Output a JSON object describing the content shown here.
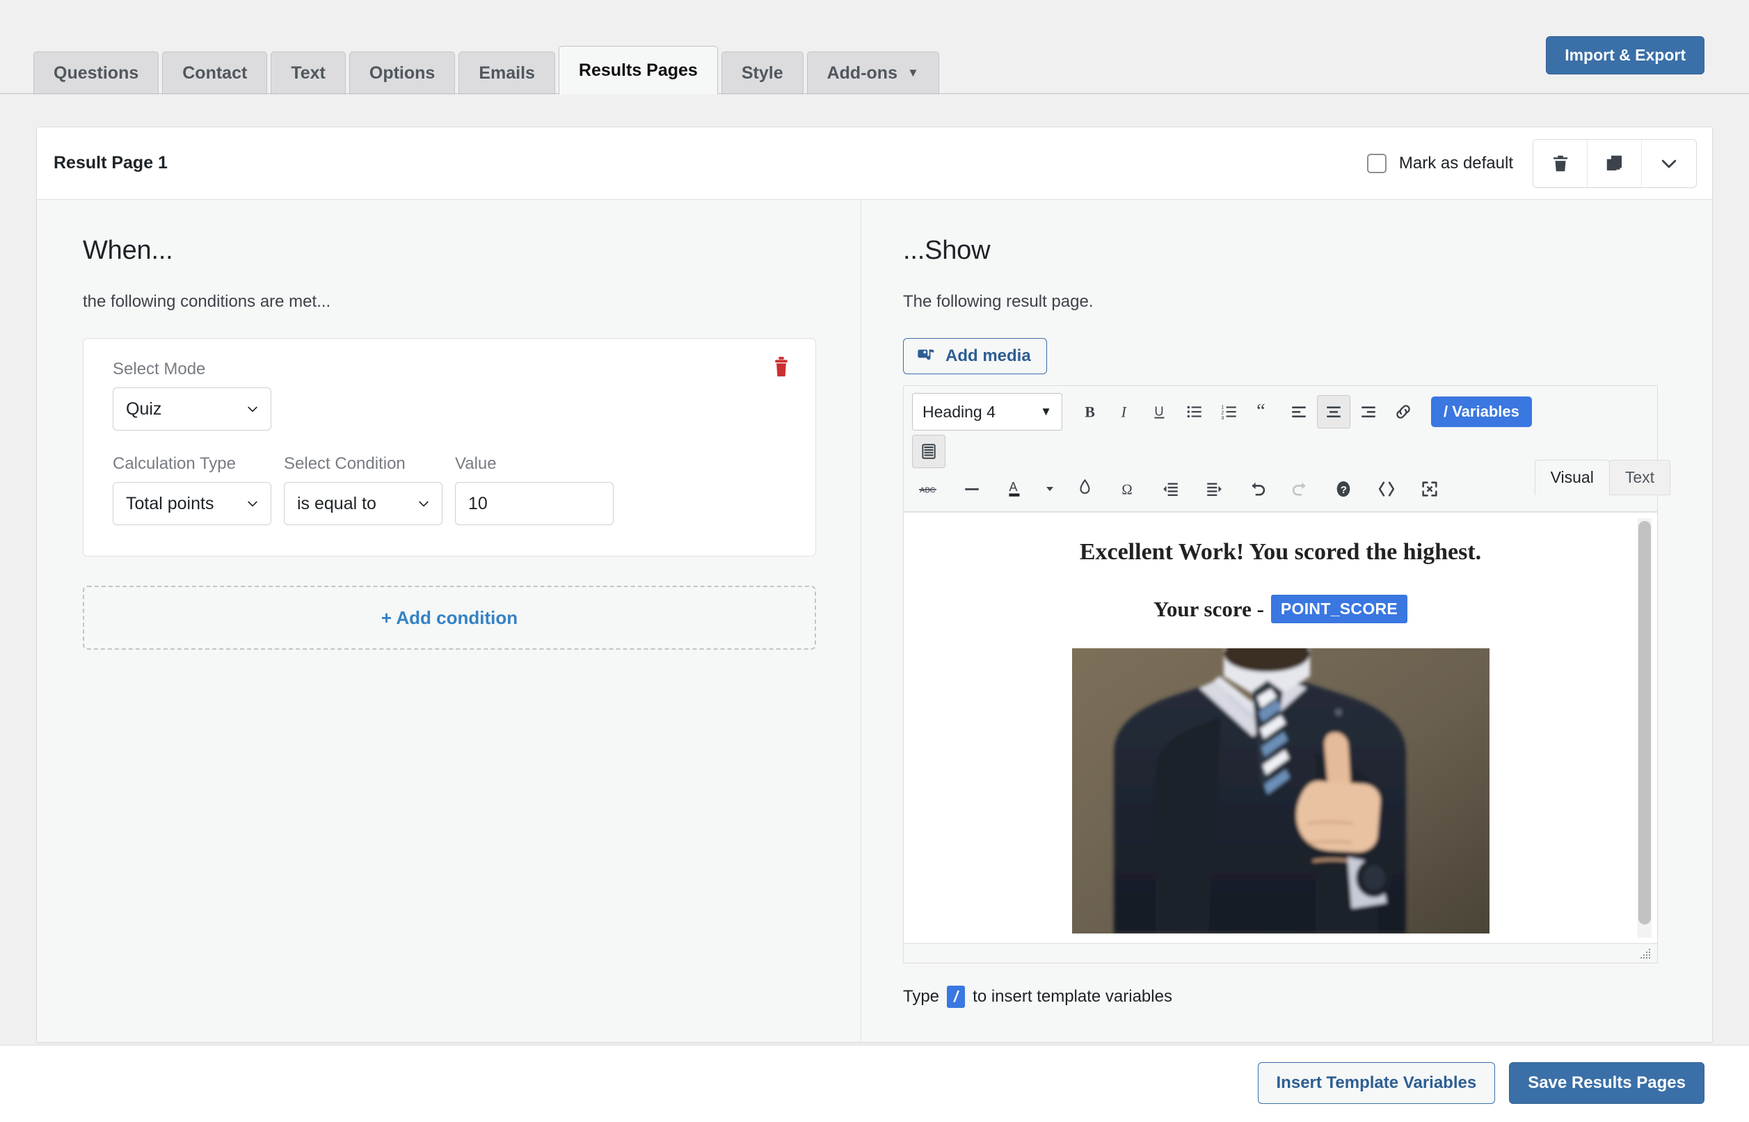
{
  "tabs": {
    "items": [
      {
        "label": "Questions",
        "active": false
      },
      {
        "label": "Contact",
        "active": false
      },
      {
        "label": "Text",
        "active": false
      },
      {
        "label": "Options",
        "active": false
      },
      {
        "label": "Emails",
        "active": false
      },
      {
        "label": "Results Pages",
        "active": true
      },
      {
        "label": "Style",
        "active": false
      },
      {
        "label": "Add-ons",
        "active": false,
        "caret": "▼"
      }
    ],
    "import_export_label": "Import & Export"
  },
  "card": {
    "title": "Result Page 1",
    "mark_default_label": "Mark as default",
    "icons": [
      "trash-icon",
      "duplicate-icon",
      "chevron-down-icon"
    ]
  },
  "when": {
    "heading": "When...",
    "subtitle": "the following conditions are met...",
    "select_mode_label": "Select Mode",
    "select_mode_value": "Quiz",
    "calculation_type_label": "Calculation Type",
    "calculation_type_value": "Total points",
    "select_condition_label": "Select Condition",
    "select_condition_value": "is equal to",
    "value_label": "Value",
    "value_value": "10",
    "value_placeholder": "",
    "add_condition_label": "+ Add condition"
  },
  "show": {
    "heading": "...Show",
    "subtitle": "The following result page.",
    "add_media_label": "Add media",
    "view_tabs": [
      {
        "label": "Visual",
        "active": true
      },
      {
        "label": "Text",
        "active": false
      }
    ],
    "toolbar": {
      "format_value": "Heading 4",
      "variables_label": "/ Variables",
      "row1_icons": [
        "bold-icon",
        "italic-icon",
        "underline-icon",
        "bulleted-list-icon",
        "numbered-list-icon",
        "blockquote-icon",
        "align-left-icon",
        "align-center-icon",
        "align-right-icon",
        "link-icon"
      ],
      "row1b_icons": [
        "table-icon"
      ],
      "row2_icons": [
        "strikethrough-icon",
        "horizontal-rule-icon",
        "text-color-icon",
        "color-dropdown-icon",
        "paste-as-text-icon",
        "special-character-icon",
        "decrease-indent-icon",
        "increase-indent-icon",
        "undo-icon",
        "redo-icon",
        "help-icon",
        "source-code-icon",
        "fullscreen-icon"
      ]
    },
    "content": {
      "heading": "Excellent Work! You scored the highest.",
      "score_prefix": "Your score -",
      "score_variable": "POINT_SCORE",
      "image_alt": "man-in-suit-thumbs-up"
    },
    "hint_prefix": "Type",
    "hint_slash": "/",
    "hint_suffix": "to insert template variables"
  },
  "footer": {
    "insert_label": "Insert Template Variables",
    "save_label": "Save Results Pages"
  },
  "colors": {
    "accent_blue": "#3a6fa8",
    "variable_blue": "#3a77e0",
    "link_blue": "#3582c4",
    "danger_red": "#cc2f2f",
    "page_bg": "#f0f0f1",
    "panel_bg": "#f6f7f7"
  }
}
